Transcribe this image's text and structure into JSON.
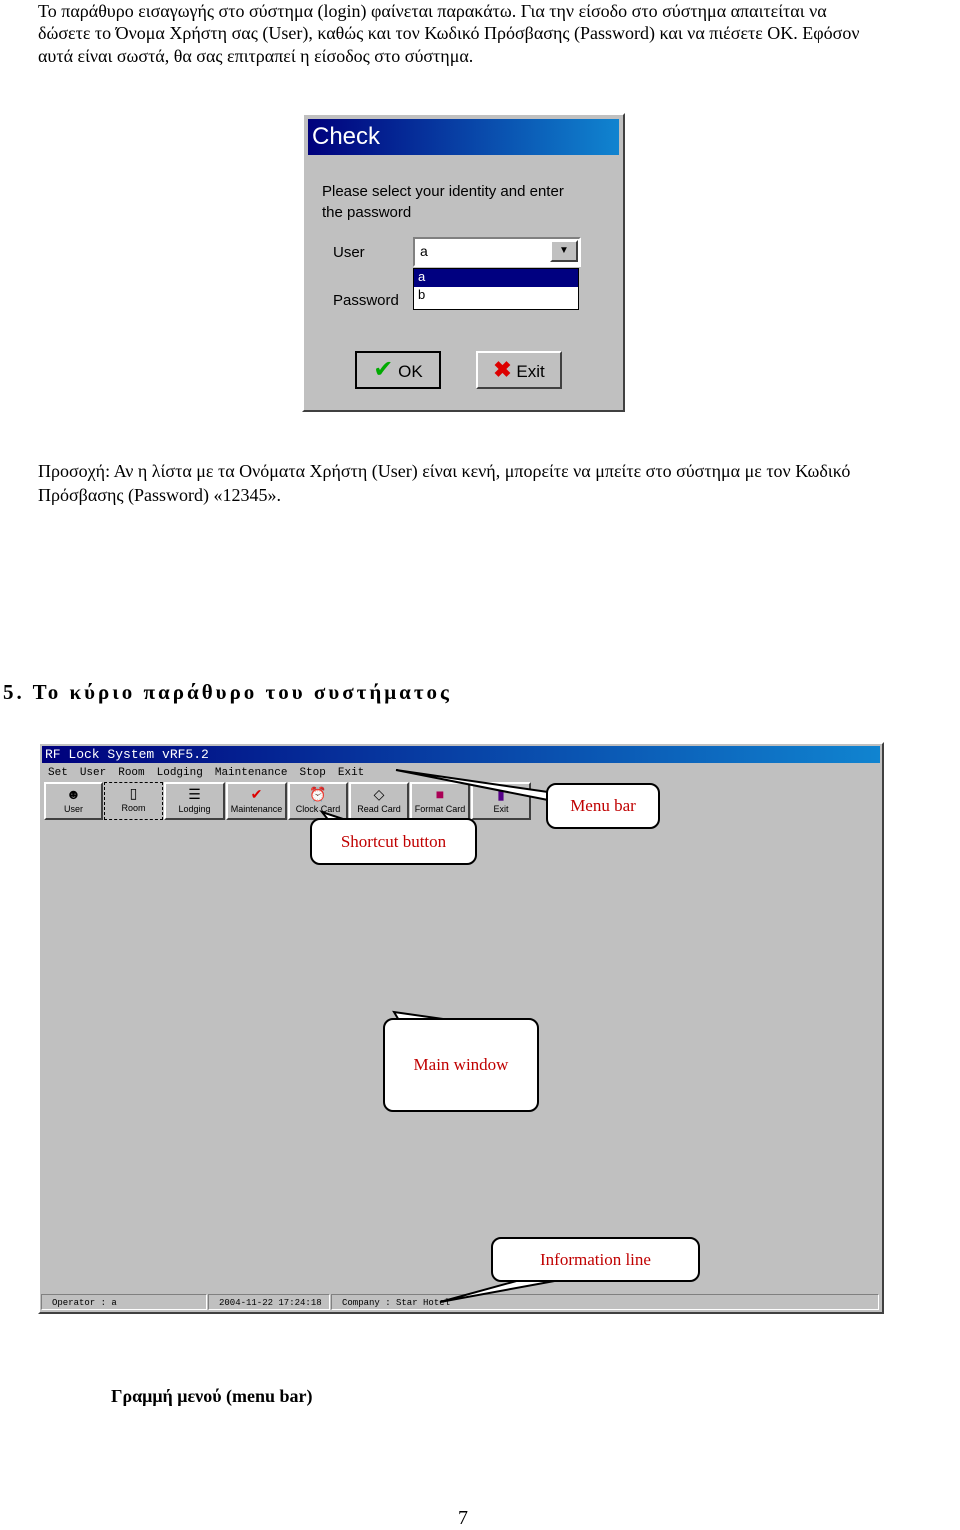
{
  "intro": [
    "Το παράθυρο εισαγωγής στο σύστημα (login)  φαίνεται παρακάτω. Για την είσοδο στο σύστημα απαιτείται να",
    "δώσετε το Όνομα Χρήστη σας (User), καθώς και τον Κωδικό Πρόσβασης (Password) και να πιέσετε ΟΚ. Εφόσον",
    "αυτά είναι σωστά, θα σας επιτραπεί η είσοδος στο σύστημα."
  ],
  "dialog": {
    "title": "Check",
    "prompt1": "Please select your identity and enter",
    "prompt2": "the password",
    "user_label": "User",
    "user_value": "a",
    "options": [
      "a",
      "b"
    ],
    "password_label": "Password",
    "ok": "OK",
    "exit": "Exit"
  },
  "note": [
    "Προσοχή:  Αν η λίστα με τα Ονόματα Χρήστη (User) είναι κενή, μπορείτε να μπείτε στο σύστημα με τον Κωδικό",
    "Πρόσβασης (Password) «12345»."
  ],
  "heading": "5.  Το κύριο παράθυρο του συστήματος",
  "app": {
    "title": "RF Lock System vRF5.2",
    "menu": [
      "Set",
      "User",
      "Room",
      "Lodging",
      "Maintenance",
      "Stop",
      "Exit"
    ],
    "toolbar": [
      {
        "label": "User",
        "icon": "user-icon"
      },
      {
        "label": "Room",
        "icon": "room-icon"
      },
      {
        "label": "Lodging",
        "icon": "lodging-icon"
      },
      {
        "label": "Maintenance",
        "icon": "check-icon"
      },
      {
        "label": "Clock Card",
        "icon": "clock-icon"
      },
      {
        "label": "Read Card",
        "icon": "card-icon"
      },
      {
        "label": "Format Card",
        "icon": "format-icon"
      },
      {
        "label": "Exit",
        "icon": "exit-icon"
      }
    ],
    "status": {
      "operator": "Operator  : a",
      "datetime": "2004-11-22 17:24:18",
      "company": "Company  : Star Hotel"
    }
  },
  "callouts": {
    "menu_bar": "Menu bar",
    "shortcut": "Shortcut button",
    "main": "Main window",
    "info": "Information line"
  },
  "caption": "Γραμμή μενού (menu bar)",
  "page_number": "7"
}
